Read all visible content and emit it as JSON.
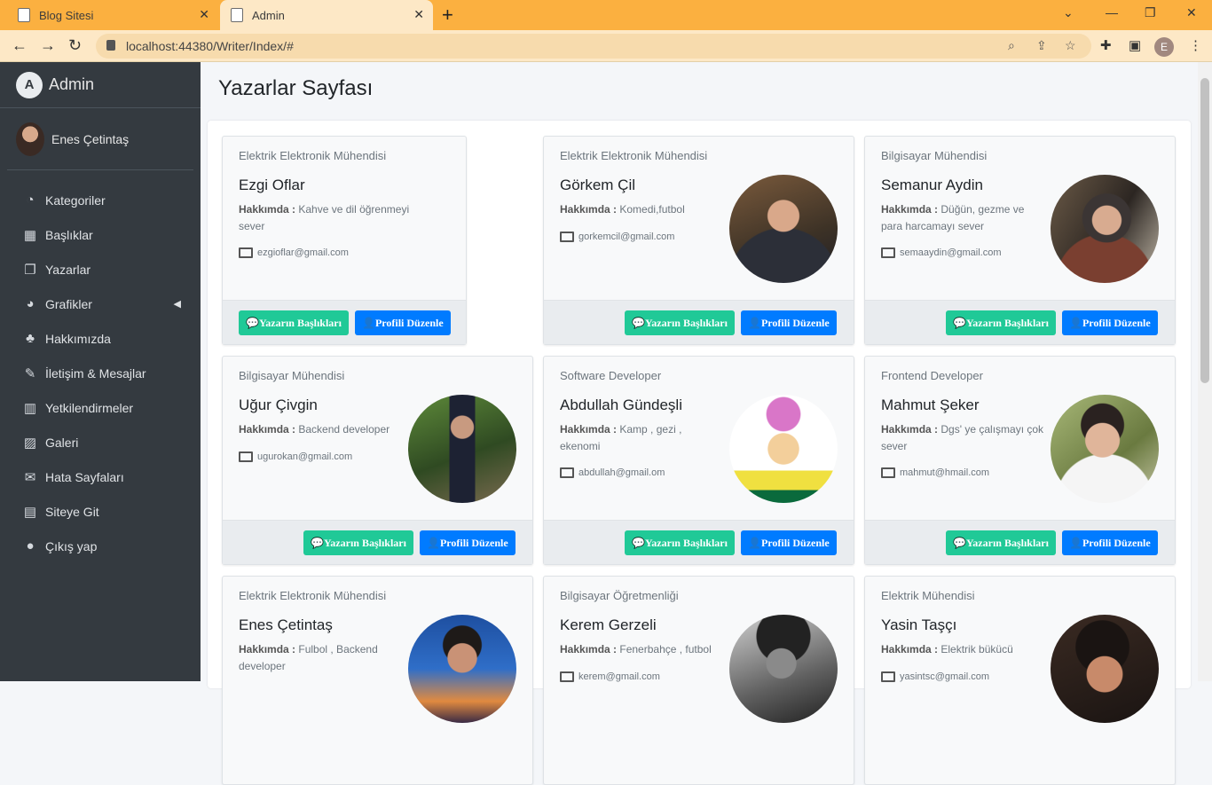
{
  "browser": {
    "tabs": [
      {
        "title": "Blog Sitesi",
        "active": false
      },
      {
        "title": "Admin",
        "active": true
      }
    ],
    "url": "localhost:44380/Writer/Index/#",
    "profile_initial": "E"
  },
  "sidebar": {
    "brand": "Admin",
    "user_name": "Enes Çetintaş",
    "items": [
      {
        "label": "Kategoriler",
        "icon": "dashboard-icon"
      },
      {
        "label": "Başlıklar",
        "icon": "grid-icon"
      },
      {
        "label": "Yazarlar",
        "icon": "file-icon"
      },
      {
        "label": "Grafikler",
        "icon": "pie-chart-icon"
      },
      {
        "label": "Hakkımızda",
        "icon": "tree-icon"
      },
      {
        "label": "İletişim & Mesajlar",
        "icon": "edit-icon"
      },
      {
        "label": "Yetkilendirmeler",
        "icon": "calendar-icon"
      },
      {
        "label": "Galeri",
        "icon": "image-icon"
      },
      {
        "label": "Hata Sayfaları",
        "icon": "envelope-icon"
      },
      {
        "label": "Siteye Git",
        "icon": "book-icon"
      },
      {
        "label": "Çıkış yap",
        "icon": "apple-icon"
      }
    ]
  },
  "main": {
    "title": "Yazarlar Sayfası",
    "about_label": "Hakkımda :",
    "btn_titles": "Yazarın Başlıkları",
    "btn_edit": "Profili Düzenle",
    "writers": [
      {
        "job": "Elektrik Elektronik Mühendisi",
        "name": "Ezgi Oflar",
        "about": "Kahve ve dil öğrenmeyi sever",
        "email": "ezgioflar@gmail.com"
      },
      {
        "job": "Elektrik Elektronik Mühendisi",
        "name": "Görkem Çil",
        "about": "Komedi,futbol",
        "email": "gorkemcil@gmail.com"
      },
      {
        "job": "Bilgisayar Mühendisi",
        "name": "Semanur Aydin",
        "about": "Düğün, gezme ve para harcamayı sever",
        "email": "semaaydin@gmail.com"
      },
      {
        "job": "Bilgisayar Mühendisi",
        "name": "Uğur Çivgin",
        "about": "Backend developer",
        "email": "ugurokan@gmail.com"
      },
      {
        "job": "Software Developer",
        "name": "Abdullah Gündeşli",
        "about": "Kamp , gezi , ekenomi",
        "email": "abdullah@gmail.om"
      },
      {
        "job": "Frontend Developer",
        "name": "Mahmut Şeker",
        "about": "Dgs' ye çalışmayı çok sever",
        "email": "mahmut@hmail.com"
      },
      {
        "job": "Elektrik Elektronik Mühendisi",
        "name": "Enes Çetintaş",
        "about": "Fulbol , Backend developer",
        "email": ""
      },
      {
        "job": "Bilgisayar Öğretmenliği",
        "name": "Kerem Gerzeli",
        "about": "Fenerbahçe , futbol",
        "email": "kerem@gmail.com"
      },
      {
        "job": "Elektrik Mühendisi",
        "name": "Yasin Taşçı",
        "about": "Elektrik bükücü",
        "email": "yasintsc@gmail.com"
      }
    ]
  }
}
